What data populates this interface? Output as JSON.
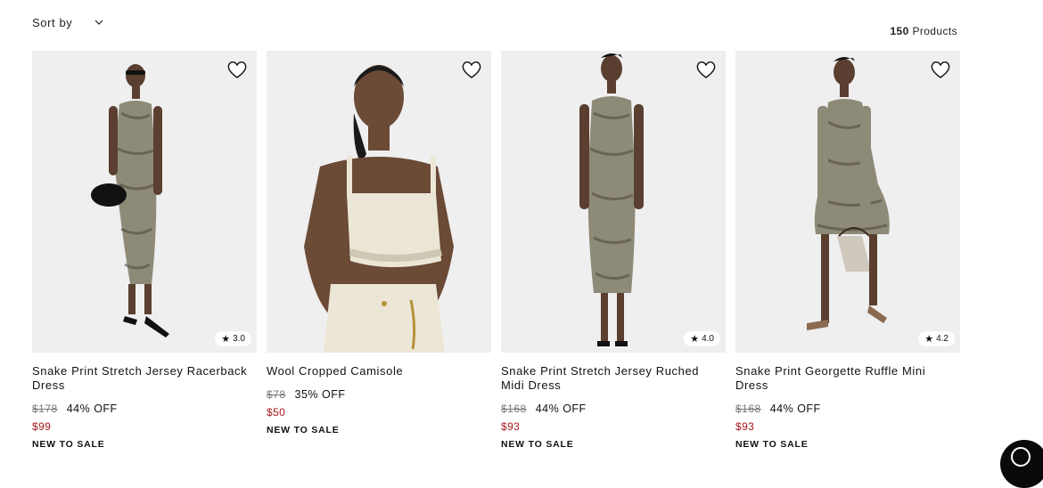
{
  "toolbar": {
    "sort_label": "Sort by",
    "count_number": "150",
    "count_suffix": "Products"
  },
  "products": [
    {
      "name": "Snake Print Stretch Jersey Racerback Dress",
      "original_price": "$178",
      "discount": "44% OFF",
      "sale_price": "$99",
      "badge": "NEW TO SALE",
      "rating": "3.0"
    },
    {
      "name": "Wool Cropped Camisole",
      "original_price": "$78",
      "discount": "35% OFF",
      "sale_price": "$50",
      "badge": "NEW TO SALE",
      "rating": ""
    },
    {
      "name": "Snake Print Stretch Jersey Ruched Midi Dress",
      "original_price": "$168",
      "discount": "44% OFF",
      "sale_price": "$93",
      "badge": "NEW TO SALE",
      "rating": "4.0"
    },
    {
      "name": "Snake Print Georgette Ruffle Mini Dress",
      "original_price": "$168",
      "discount": "44% OFF",
      "sale_price": "$93",
      "badge": "NEW TO SALE",
      "rating": "4.2"
    }
  ],
  "colors": {
    "sale_price": "#a6191e",
    "image_background": "#efefef",
    "snake_print": "#8e8a78",
    "camisole": "#ece6d6"
  },
  "icons": {
    "sort": "chevron-down-icon",
    "wishlist": "heart-icon",
    "rating": "star-icon",
    "chat": "chat-icon"
  }
}
